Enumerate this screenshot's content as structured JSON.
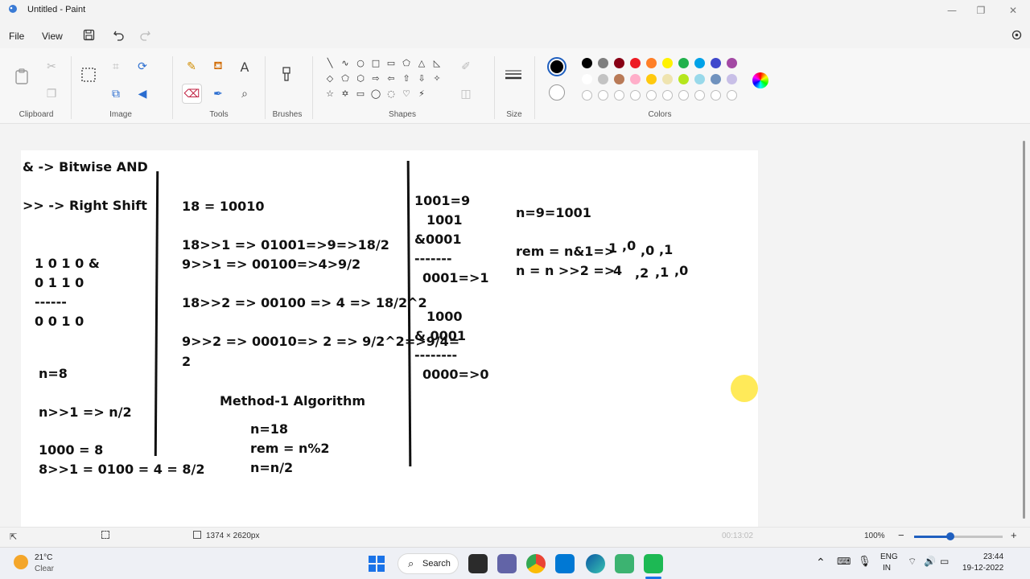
{
  "window": {
    "title": "Untitled - Paint",
    "minimize_glyph": "—",
    "maximize_glyph": "❐",
    "close_glyph": "✕"
  },
  "menu": {
    "file": "File",
    "view": "View"
  },
  "toolbar_icons": [
    "save-icon",
    "undo-icon",
    "redo-icon",
    "settings-icon"
  ],
  "ribbon": {
    "groups": [
      {
        "key": "clipboard",
        "label": "Clipboard"
      },
      {
        "key": "image",
        "label": "Image"
      },
      {
        "key": "tools",
        "label": "Tools"
      },
      {
        "key": "brushes",
        "label": "Brushes"
      },
      {
        "key": "shapes",
        "label": "Shapes"
      },
      {
        "key": "size",
        "label": "Size"
      },
      {
        "key": "colors",
        "label": "Colors"
      }
    ],
    "colors": {
      "primary": "#000000",
      "secondary": "#ffffff",
      "row1": [
        "#000000",
        "#7f7f7f",
        "#880015",
        "#ed1c24",
        "#ff7f27",
        "#fff200",
        "#22b14c",
        "#00a2e8",
        "#3f48cc",
        "#a349a4"
      ],
      "row2": [
        "#ffffff",
        "#c3c3c3",
        "#b97a57",
        "#ffaec9",
        "#ffc90e",
        "#efe4b0",
        "#b5e61d",
        "#99d9ea",
        "#7092be",
        "#c8bfe7"
      ]
    }
  },
  "canvas_notes": {
    "col1": [
      "& -> Bitwise AND",
      ">> -> Right Shift",
      "1 0 1 0  &",
      "0 1 1 0",
      "------",
      "0 0 1 0",
      "n=8",
      "n>>1 => n/2",
      "1000 = 8",
      "8>>1 = 0100 = 4 = 8/2"
    ],
    "col2": [
      "18 = 10010",
      "18>>1 => 01001=>9=>18/2",
      "9>>1 => 00100=>4>9/2",
      "18>>2 => 00100 => 4 => 18/2^2",
      "9>>2 => 00010=> 2 => 9/2^2=>9/4=",
      "2",
      "Method-1 Algorithm",
      "n=18",
      "rem = n%2",
      "n=n/2"
    ],
    "col3": [
      "1001=9",
      "1001",
      "&0001",
      "-------",
      "0001=>1",
      "1000",
      "& 0001",
      "--------",
      "0000=>0"
    ],
    "col4": [
      "n=9=1001",
      "rem = n&1=>",
      "1",
      ",0",
      ",0",
      ",1",
      "n = n >>2  =>",
      "4",
      ",2",
      ",1",
      ",0"
    ]
  },
  "status": {
    "canvas_size": "1374 × 2620px",
    "zoom": "100%",
    "time_display": "00:13:02"
  },
  "taskbar": {
    "weather_temp": "21°C",
    "weather_desc": "Clear",
    "search": "Search",
    "lang1": "ENG",
    "lang2": "IN",
    "time": "23:44",
    "date": "19-12-2022"
  }
}
